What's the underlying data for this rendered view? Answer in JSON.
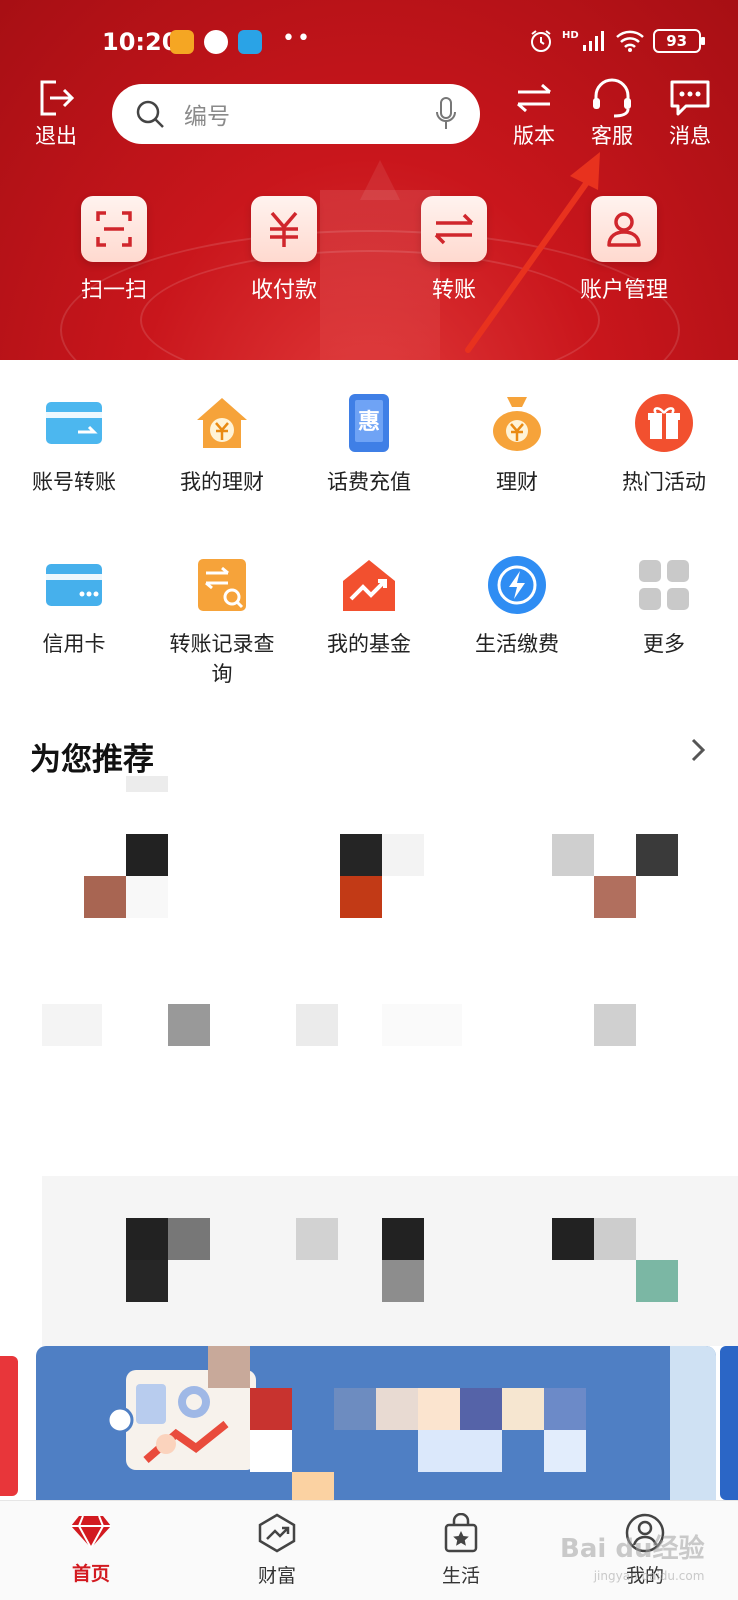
{
  "status_bar": {
    "time": "10:20",
    "dots": "••",
    "hd": "HD",
    "battery": "93"
  },
  "header": {
    "logout_label": "退出",
    "search_placeholder": "编号",
    "version_label": "版本",
    "service_label": "客服",
    "message_label": "消息"
  },
  "quick_actions": [
    {
      "label": "扫一扫",
      "icon": "scan-icon"
    },
    {
      "label": "收付款",
      "icon": "yuan-icon"
    },
    {
      "label": "转账",
      "icon": "transfer-icon"
    },
    {
      "label": "账户管理",
      "icon": "account-icon"
    }
  ],
  "services": [
    {
      "label": "账号转账",
      "icon": "card-transfer-icon"
    },
    {
      "label": "我的理财",
      "icon": "house-yuan-icon"
    },
    {
      "label": "话费充值",
      "icon": "phone-topup-icon",
      "glyph": "惠"
    },
    {
      "label": "理财",
      "icon": "money-bag-icon"
    },
    {
      "label": "热门活动",
      "icon": "gift-icon"
    },
    {
      "label": "信用卡",
      "icon": "credit-card-icon"
    },
    {
      "label": "转账记录查询",
      "icon": "transfer-search-icon"
    },
    {
      "label": "我的基金",
      "icon": "fund-icon"
    },
    {
      "label": "生活缴费",
      "icon": "bolt-icon"
    },
    {
      "label": "更多",
      "icon": "more-grid-icon"
    }
  ],
  "recommend": {
    "title": "为您推荐"
  },
  "bottom_nav": [
    {
      "label": "首页",
      "icon": "diamond-icon",
      "active": true
    },
    {
      "label": "财富",
      "icon": "wealth-icon",
      "active": false
    },
    {
      "label": "生活",
      "icon": "shopping-bag-icon",
      "active": false
    },
    {
      "label": "我的",
      "icon": "user-icon",
      "active": false
    }
  ],
  "watermark": {
    "text": "Bai du经验",
    "sub": "jingyan.baidu.com"
  },
  "colors": {
    "brand_red": "#c9161c",
    "active_red": "#d21a20",
    "arrow_red": "#e8321e"
  }
}
